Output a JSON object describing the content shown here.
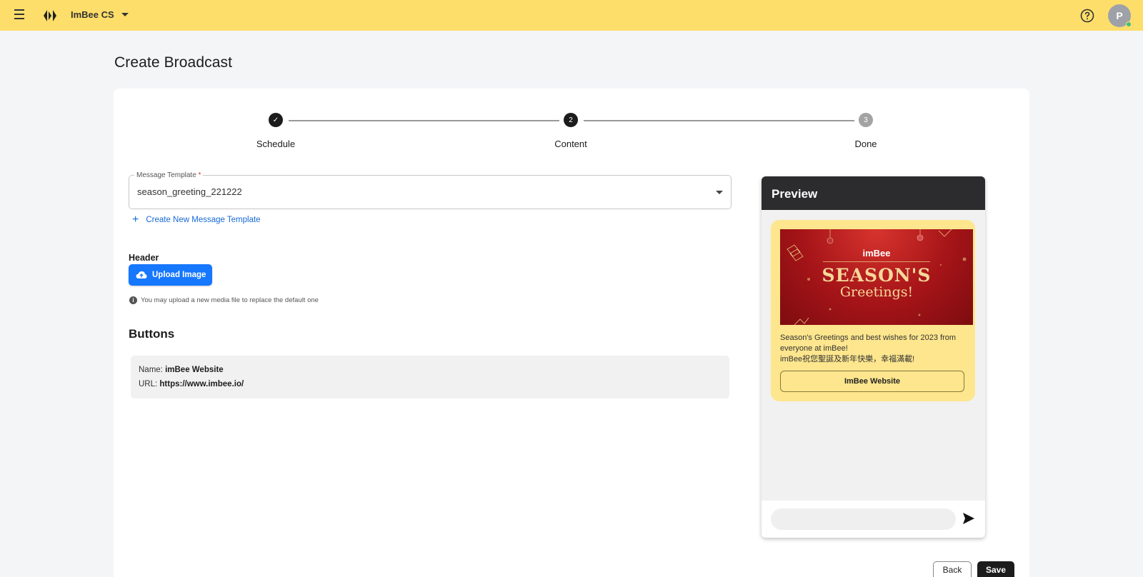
{
  "topbar": {
    "org_name": "ImBee CS",
    "avatar_initial": "P"
  },
  "page": {
    "title": "Create Broadcast"
  },
  "stepper": {
    "steps": [
      {
        "label": "Schedule",
        "marker": "✓",
        "state": "completed"
      },
      {
        "label": "Content",
        "marker": "2",
        "state": "active"
      },
      {
        "label": "Done",
        "marker": "3",
        "state": "pending"
      }
    ]
  },
  "form": {
    "template_label": "Message Template",
    "template_required_mark": "*",
    "template_value": "season_greeting_221222",
    "create_template_link": "Create New Message Template",
    "header_label": "Header",
    "upload_button": "Upload Image",
    "upload_hint": "You may upload a new media file to replace the default one",
    "buttons_title": "Buttons",
    "button_entry": {
      "name_label": "Name:",
      "name_value": "imBee Website",
      "url_label": "URL:",
      "url_value": "https://www.imbee.io/"
    }
  },
  "preview": {
    "title": "Preview",
    "banner": {
      "brand": "imBee",
      "title": "SEASON'S",
      "subtitle": "Greetings!"
    },
    "message_line1": "Season's Greetings and best wishes for 2023 from everyone at imBee!",
    "message_line2": "imBee祝您聖誕及新年快樂，幸福滿載!",
    "cta_button": "ImBee Website"
  },
  "actions": {
    "back": "Back",
    "save": "Save"
  },
  "colors": {
    "topbar": "#fede6a",
    "primary_blue": "#1677ff",
    "dark": "#1c1c1c",
    "bubble": "#fde68d"
  }
}
